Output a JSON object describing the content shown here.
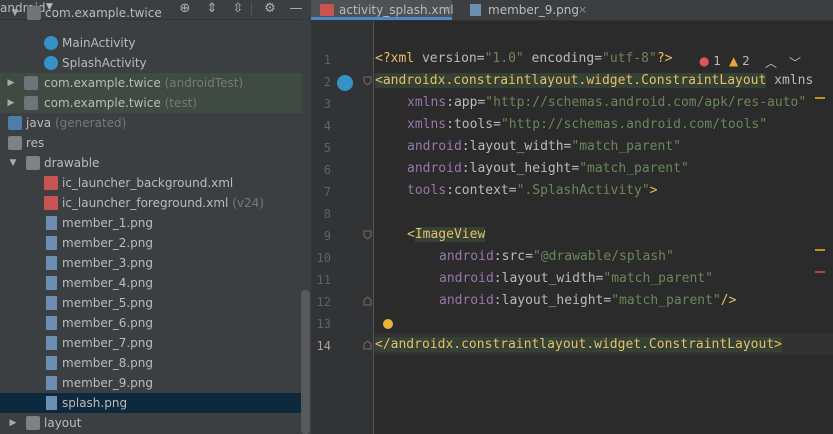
{
  "project": {
    "title": "android",
    "items": [
      {
        "label": "com.example.twice",
        "suffix": ""
      },
      {
        "label": "MainActivity",
        "suffix": ""
      },
      {
        "label": "SplashActivity",
        "suffix": ""
      },
      {
        "label": "com.example.twice",
        "suffix": "(androidTest)"
      },
      {
        "label": "com.example.twice",
        "suffix": "(test)"
      },
      {
        "label": "java",
        "suffix": "(generated)"
      },
      {
        "label": "res",
        "suffix": ""
      },
      {
        "label": "drawable",
        "suffix": ""
      },
      {
        "label": "ic_launcher_background.xml",
        "suffix": ""
      },
      {
        "label": "ic_launcher_foreground.xml",
        "suffix": "(v24)"
      },
      {
        "label": "member_1.png",
        "suffix": ""
      },
      {
        "label": "member_2.png",
        "suffix": ""
      },
      {
        "label": "member_3.png",
        "suffix": ""
      },
      {
        "label": "member_4.png",
        "suffix": ""
      },
      {
        "label": "member_5.png",
        "suffix": ""
      },
      {
        "label": "member_6.png",
        "suffix": ""
      },
      {
        "label": "member_7.png",
        "suffix": ""
      },
      {
        "label": "member_8.png",
        "suffix": ""
      },
      {
        "label": "member_9.png",
        "suffix": ""
      },
      {
        "label": "splash.png",
        "suffix": ""
      },
      {
        "label": "layout",
        "suffix": ""
      }
    ]
  },
  "tabs": [
    {
      "label": "activity_splash.xml",
      "close": "×"
    },
    {
      "label": "member_9.png",
      "close": "×"
    }
  ],
  "inspections": {
    "errors": "1",
    "warnings": "2"
  },
  "gutter": {
    "line_numbers": [
      "1",
      "2",
      "3",
      "4",
      "5",
      "6",
      "7",
      "8",
      "9",
      "10",
      "11",
      "12",
      "13",
      "14"
    ]
  },
  "code": {
    "l1": {
      "open": "<?xml ",
      "a1": "version",
      "eq1": "=",
      "v1": "\"1.0\"",
      "a2": " encoding",
      "eq2": "=",
      "v2": "\"utf-8\"",
      "close": "?>"
    },
    "l2": {
      "open": "<androidx.constraintlayout.widget.ConstraintLayout",
      "attr": " xmlns"
    },
    "l3": {
      "ns": "xmlns",
      "colon": ":",
      "attr": "app",
      "eq": "=",
      "val": "\"http://schemas.android.com/apk/res-auto\""
    },
    "l4": {
      "ns": "xmlns",
      "colon": ":",
      "attr": "tools",
      "eq": "=",
      "val": "\"http://schemas.android.com/tools\""
    },
    "l5": {
      "ns": "android",
      "colon": ":",
      "attr": "layout_width",
      "eq": "=",
      "val": "\"match_parent\""
    },
    "l6": {
      "ns": "android",
      "colon": ":",
      "attr": "layout_height",
      "eq": "=",
      "val": "\"match_parent\""
    },
    "l7": {
      "ns": "tools",
      "colon": ":",
      "attr": "context",
      "eq": "=",
      "val": "\".SplashActivity\"",
      "close": ">"
    },
    "l9": {
      "open": "<",
      "tag": "ImageView"
    },
    "l10": {
      "ns": "android",
      "colon": ":",
      "attr": "src",
      "eq": "=",
      "val": "\"@drawable/splash\""
    },
    "l11": {
      "ns": "android",
      "colon": ":",
      "attr": "layout_width",
      "eq": "=",
      "val": "\"match_parent\""
    },
    "l12": {
      "ns": "android",
      "colon": ":",
      "attr": "layout_height",
      "eq": "=",
      "val": "\"match_parent\"",
      "close": "/>"
    },
    "l14": {
      "text": "</androidx.constraintlayout.widget.ConstraintLayout>"
    }
  },
  "colors": {
    "selection": "#0d293e",
    "accent": "#4a88c7",
    "tag": "#e8bf6a",
    "value": "#6a8759",
    "namespace": "#9876aa"
  },
  "icons": [
    "settings-icon",
    "collapse-all-icon",
    "expand-all-icon",
    "locate-icon",
    "minimize-icon",
    "error-icon",
    "warning-icon",
    "bulb-icon"
  ]
}
